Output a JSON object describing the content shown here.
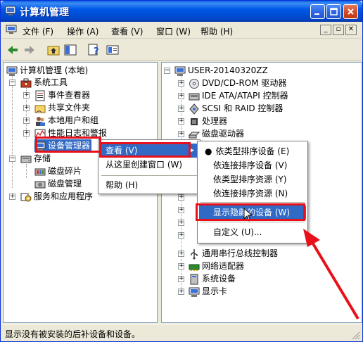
{
  "window": {
    "title": "计算机管理"
  },
  "menu": [
    "文件 (F)",
    "操作 (A)",
    "查看 (V)",
    "窗口 (W)",
    "帮助 (H)"
  ],
  "left_tree": {
    "root": "计算机管理 (本地)",
    "system_tools": "系统工具",
    "event_viewer": "事件查看器",
    "shared_folders": "共享文件夹",
    "local_users": "本地用户和组",
    "perf_logs": "性能日志和警报",
    "device_manager": "设备管理器",
    "storage": "存储",
    "disk_defrag": "磁盘碎片",
    "disk_mgmt": "磁盘管理",
    "services": "服务和应用程序"
  },
  "right_tree": {
    "computer": "USER-20140320ZZ",
    "items": [
      "DVD/CD-ROM 驱动器",
      "IDE ATA/ATAPI 控制器",
      "SCSI 和 RAID 控制器",
      "处理器",
      "磁盘驱动器"
    ],
    "lower_items": [
      "通用串行总线控制器",
      "网络适配器",
      "系统设备",
      "显示卡"
    ]
  },
  "context_menu_1": {
    "view": "查看 (V)",
    "new_window": "从这里创建窗口 (W)",
    "help": "帮助 (H)"
  },
  "context_menu_2": {
    "by_type_device": "依类型排序设备 (E)",
    "by_conn_device": "依连接排序设备 (V)",
    "by_type_resource": "依类型排序资源 (Y)",
    "by_conn_resource": "依连接排序资源 (N)",
    "show_hidden": "显示隐藏的设备 (W)",
    "customize": "自定义 (U)..."
  },
  "status": "显示没有被安装的后补设备和设备。",
  "watermark": "Bai 经验",
  "colors": {
    "accent": "#316ac5",
    "title_blue": "#0054e3",
    "annotation_red": "#e8101a"
  }
}
